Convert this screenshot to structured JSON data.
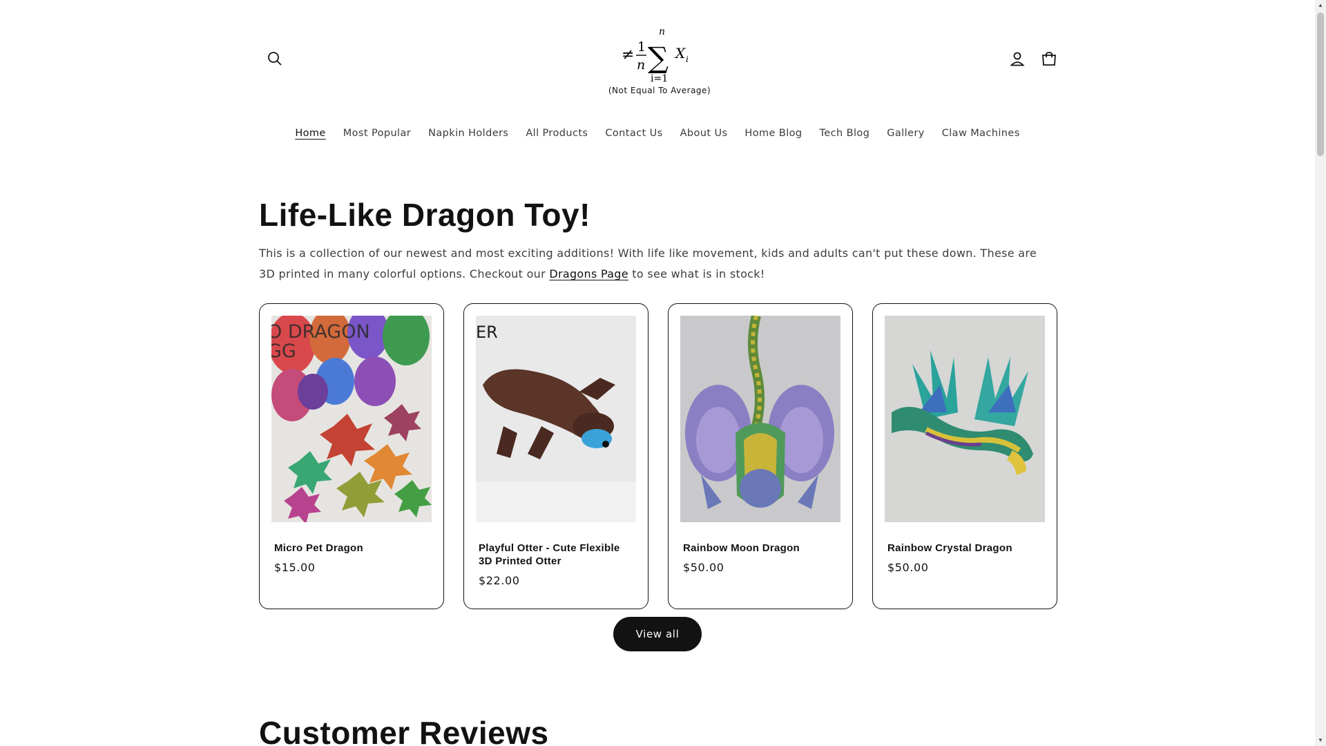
{
  "header": {
    "logo_caption": "(Not Equal To Average)",
    "logo_formula": {
      "neq": "≠",
      "numerator": "1",
      "denominator": "n",
      "sum": "∑",
      "upper": "n",
      "lower": "i=1",
      "var": "X",
      "sub": "i"
    },
    "icons": {
      "search": "search-icon",
      "account": "account-icon",
      "cart": "cart-icon"
    }
  },
  "nav": {
    "items": [
      {
        "label": "Home",
        "active": true
      },
      {
        "label": "Most Popular"
      },
      {
        "label": "Napkin Holders"
      },
      {
        "label": "All Products"
      },
      {
        "label": "Contact Us"
      },
      {
        "label": "About Us"
      },
      {
        "label": "Home Blog"
      },
      {
        "label": "Tech Blog"
      },
      {
        "label": "Gallery"
      },
      {
        "label": "Claw Machines"
      }
    ]
  },
  "featured": {
    "title": "Life-Like Dragon Toy!",
    "desc_part1": "This is a collection of our newest and most exciting additions! With life like movement, kids and adults can't put these down. These are 3D printed in many colorful options. Checkout our ",
    "desc_link": "Dragons Page",
    "desc_part2": " to see what is in stock!",
    "products": [
      {
        "title": "Micro Pet Dragon",
        "price": "$15.00",
        "image_text": "O DRAGON\nGG"
      },
      {
        "title": "Playful Otter - Cute Flexible 3D Printed Otter",
        "price": "$22.00",
        "image_text": "ER"
      },
      {
        "title": "Rainbow Moon Dragon",
        "price": "$50.00"
      },
      {
        "title": "Rainbow Crystal Dragon",
        "price": "$50.00"
      }
    ],
    "view_all": "View all"
  },
  "reviews": {
    "title": "Customer Reviews"
  },
  "colors": {
    "text": "#121212",
    "button_bg": "#121212",
    "button_text": "#ffffff",
    "border": "#121212"
  }
}
